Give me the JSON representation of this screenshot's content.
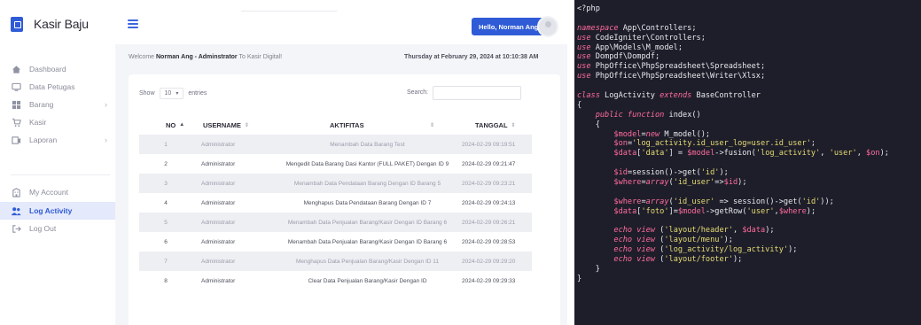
{
  "app": {
    "brand": "Kasir Baju",
    "nav": [
      {
        "label": "Dashboard",
        "icon": "home-icon",
        "chevron": false,
        "active": false
      },
      {
        "label": "Data Petugas",
        "icon": "monitor-icon",
        "chevron": false,
        "active": false
      },
      {
        "label": "Barang",
        "icon": "box-icon",
        "chevron": true,
        "active": false
      },
      {
        "label": "Kasir",
        "icon": "cart-icon",
        "chevron": false,
        "active": false
      },
      {
        "label": "Laporan",
        "icon": "report-icon",
        "chevron": true,
        "active": false
      },
      {
        "label": "My Account",
        "icon": "building-icon",
        "chevron": false,
        "active": false
      },
      {
        "label": "Log Activity",
        "icon": "users-icon",
        "chevron": false,
        "active": true
      },
      {
        "label": "Log Out",
        "icon": "logout-icon",
        "chevron": false,
        "active": false
      }
    ],
    "header": {
      "hello": "Hello, Norman Ang"
    },
    "welcome": {
      "prefix": "Welcome ",
      "name": "Norman Ang - Adminstrator",
      "suffix": " To Kasir Digital!"
    },
    "datetime": "Thursday at February 29, 2024 at 10:10:38 AM",
    "table_controls": {
      "show_label": "Show",
      "entries_value": "10",
      "entries_label": "entries",
      "search_label": "Search:",
      "search_value": ""
    },
    "columns": [
      "NO",
      "USERNAME",
      "AKTIFITAS",
      "TANGGAL"
    ],
    "rows": [
      {
        "no": "1",
        "username": "Administrator",
        "aktifitas": "Menambah Data Barang Test",
        "tanggal": "2024-02-29 09:19:51"
      },
      {
        "no": "2",
        "username": "Administrator",
        "aktifitas": "Mengedit Data Barang Dasi Kantor (FULL PAKET) Dengan ID 9",
        "tanggal": "2024-02-29 09:21:47"
      },
      {
        "no": "3",
        "username": "Administrator",
        "aktifitas": "Menambah Data Pendataan Barang Dengan ID Barang 5",
        "tanggal": "2024-02-29 09:23:21"
      },
      {
        "no": "4",
        "username": "Administrator",
        "aktifitas": "Menghapus Data Pendataan Barang Dengan ID 7",
        "tanggal": "2024-02-29 09:24:13"
      },
      {
        "no": "5",
        "username": "Administrator",
        "aktifitas": "Menambah Data Penjualan Barang/Kasir Dengan ID Barang 6",
        "tanggal": "2024-02-29 09:26:21"
      },
      {
        "no": "6",
        "username": "Administrator",
        "aktifitas": "Menambah Data Penjualan Barang/Kasir Dengan ID Barang 6",
        "tanggal": "2024-02-29 09:28:53"
      },
      {
        "no": "7",
        "username": "Administrator",
        "aktifitas": "Menghapus Data Penjualan Barang/Kasir Dengan ID 11",
        "tanggal": "2024-02-29 09:29:20"
      },
      {
        "no": "8",
        "username": "Administrator",
        "aktifitas": "Clear Data Penjualan Barang/Kasir Dengan ID",
        "tanggal": "2024-02-29 09:29:33"
      }
    ]
  },
  "code": {
    "lines": [
      "<?php",
      "",
      "namespace App\\Controllers;",
      "use CodeIgniter\\Controllers;",
      "use App\\Models\\M_model;",
      "use Dompdf\\Dompdf;",
      "use PhpOffice\\PhpSpreadsheet\\Spreadsheet;",
      "use PhpOffice\\PhpSpreadsheet\\Writer\\Xlsx;",
      "",
      "class LogActivity extends BaseController",
      "{",
      "    public function index()",
      "    {",
      "        $model=new M_model();",
      "        $on='log_activity.id_user_log=user.id_user';",
      "        $data['data'] = $model->fusion('log_activity', 'user', $on);",
      "",
      "        $id=session()->get('id');",
      "        $where=array('id_user'=>$id);",
      "",
      "        $where=array('id_user' => session()->get('id'));",
      "        $data['foto']=$model->getRow('user',$where);",
      "",
      "        echo view ('layout/header', $data);",
      "        echo view ('layout/menu');",
      "        echo view ('log_activity/log_activity');",
      "        echo view ('layout/footer');",
      "    }",
      "}"
    ]
  }
}
